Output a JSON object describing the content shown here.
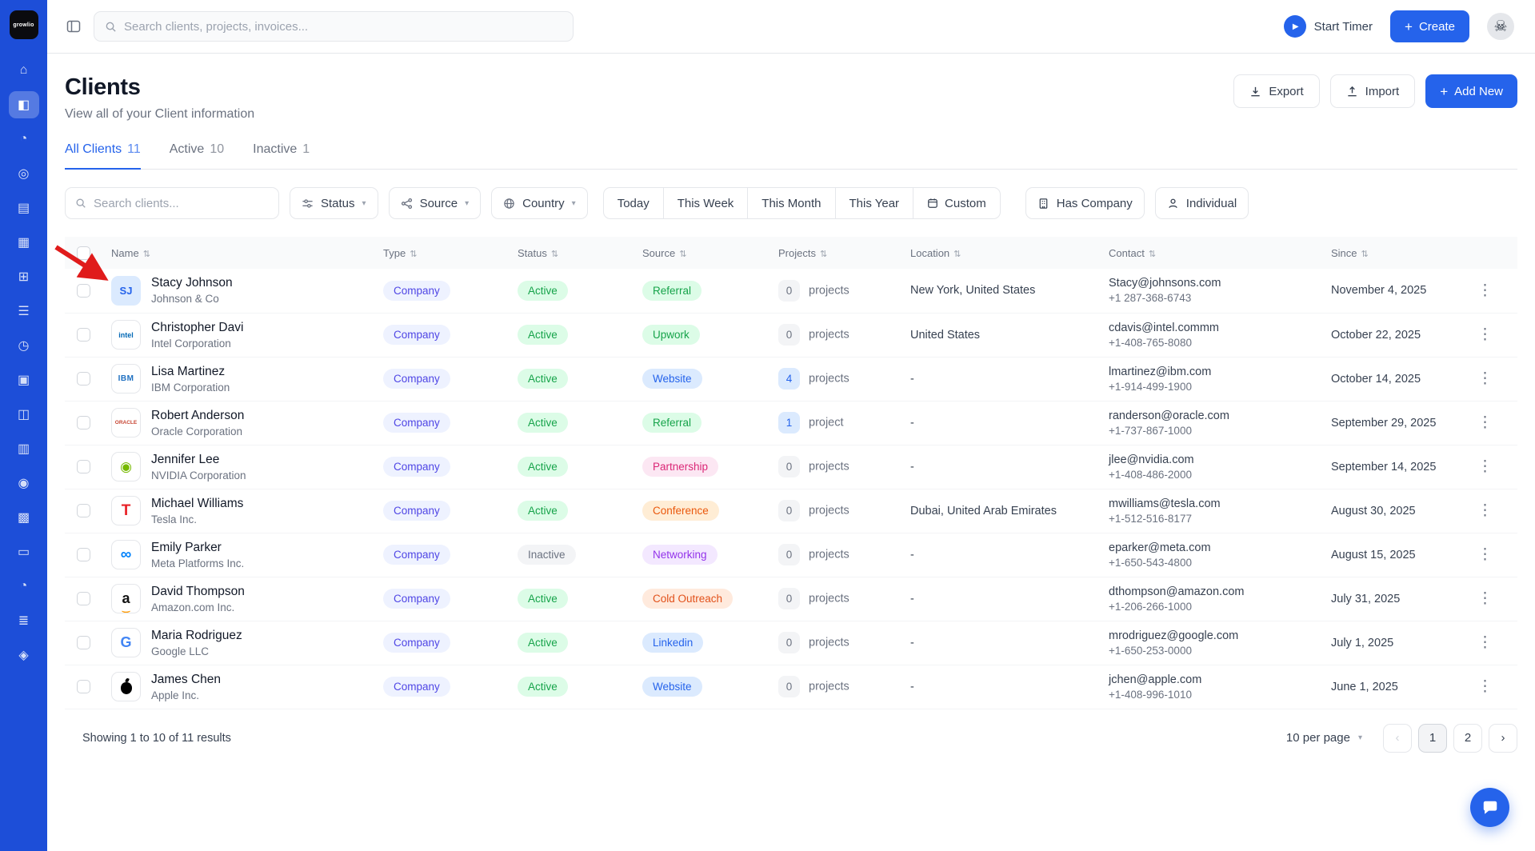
{
  "brand": "growlio",
  "colors": {
    "accent": "#2563eb",
    "sidebar": "#1d4ed8"
  },
  "sidebar": {
    "active": "clients",
    "icons": [
      "home",
      "clients",
      "contacts",
      "payments",
      "projects",
      "layers",
      "products",
      "tasks",
      "time",
      "inventory",
      "store",
      "billing",
      "finance",
      "modules",
      "cards",
      "history",
      "reports",
      "team"
    ]
  },
  "topbar": {
    "search_placeholder": "Search clients, projects, invoices...",
    "start_timer_label": "Start Timer",
    "create_label": "Create"
  },
  "page": {
    "title": "Clients",
    "subtitle": "View all of your Client information",
    "export_label": "Export",
    "import_label": "Import",
    "add_new_label": "Add New"
  },
  "tabs": [
    {
      "label": "All Clients",
      "count": "11"
    },
    {
      "label": "Active",
      "count": "10"
    },
    {
      "label": "Inactive",
      "count": "1"
    }
  ],
  "filters": {
    "search_placeholder": "Search clients...",
    "status_label": "Status",
    "source_label": "Source",
    "country_label": "Country",
    "date_ranges": [
      "Today",
      "This Week",
      "This Month",
      "This Year",
      "Custom"
    ],
    "has_company_label": "Has Company",
    "individual_label": "Individual"
  },
  "table": {
    "columns": [
      "Name",
      "Type",
      "Status",
      "Source",
      "Projects",
      "Location",
      "Contact",
      "Since"
    ],
    "rows": [
      {
        "name": "Stacy Johnson",
        "company": "Johnson & Co",
        "avatar": {
          "text": "SJ",
          "style": "sj"
        },
        "type": "Company",
        "status": "Active",
        "source": {
          "label": "Referral",
          "color": "green"
        },
        "projects": {
          "count": "0",
          "label": "projects"
        },
        "location": "New York, United States",
        "email": "Stacy@johnsons.com",
        "phone": "+1 287-368-6743",
        "since": "November 4, 2025"
      },
      {
        "name": "Christopher Davi",
        "company": "Intel Corporation",
        "avatar": {
          "text": "intel",
          "style": "intel"
        },
        "type": "Company",
        "status": "Active",
        "source": {
          "label": "Upwork",
          "color": "green"
        },
        "projects": {
          "count": "0",
          "label": "projects"
        },
        "location": "United States",
        "email": "cdavis@intel.commm",
        "phone": "+1-408-765-8080",
        "since": "October 22, 2025"
      },
      {
        "name": "Lisa Martinez",
        "company": "IBM Corporation",
        "avatar": {
          "text": "IBM",
          "style": "ibm"
        },
        "type": "Company",
        "status": "Active",
        "source": {
          "label": "Website",
          "color": "blue"
        },
        "projects": {
          "count": "4",
          "label": "projects"
        },
        "location": "-",
        "email": "lmartinez@ibm.com",
        "phone": "+1-914-499-1900",
        "since": "October 14, 2025"
      },
      {
        "name": "Robert Anderson",
        "company": "Oracle Corporation",
        "avatar": {
          "text": "ORACLE",
          "style": "oracle"
        },
        "type": "Company",
        "status": "Active",
        "source": {
          "label": "Referral",
          "color": "green"
        },
        "projects": {
          "count": "1",
          "label": "project"
        },
        "location": "-",
        "email": "randerson@oracle.com",
        "phone": "+1-737-867-1000",
        "since": "September 29, 2025"
      },
      {
        "name": "Jennifer Lee",
        "company": "NVIDIA Corporation",
        "avatar": {
          "text": "◉",
          "style": "nvidia"
        },
        "type": "Company",
        "status": "Active",
        "source": {
          "label": "Partnership",
          "color": "pink"
        },
        "projects": {
          "count": "0",
          "label": "projects"
        },
        "location": "-",
        "email": "jlee@nvidia.com",
        "phone": "+1-408-486-2000",
        "since": "September 14, 2025"
      },
      {
        "name": "Michael Williams",
        "company": "Tesla Inc.",
        "avatar": {
          "text": "T",
          "style": "tesla"
        },
        "type": "Company",
        "status": "Active",
        "source": {
          "label": "Conference",
          "color": "orange"
        },
        "projects": {
          "count": "0",
          "label": "projects"
        },
        "location": "Dubai, United Arab Emirates",
        "email": "mwilliams@tesla.com",
        "phone": "+1-512-516-8177",
        "since": "August 30, 2025"
      },
      {
        "name": "Emily Parker",
        "company": "Meta Platforms Inc.",
        "avatar": {
          "text": "∞",
          "style": "meta"
        },
        "type": "Company",
        "status": "Inactive",
        "source": {
          "label": "Networking",
          "color": "purple"
        },
        "projects": {
          "count": "0",
          "label": "projects"
        },
        "location": "-",
        "email": "eparker@meta.com",
        "phone": "+1-650-543-4800",
        "since": "August 15, 2025"
      },
      {
        "name": "David Thompson",
        "company": "Amazon.com Inc.",
        "avatar": {
          "text": "a",
          "style": "amazon"
        },
        "type": "Company",
        "status": "Active",
        "source": {
          "label": "Cold Outreach",
          "color": "coral"
        },
        "projects": {
          "count": "0",
          "label": "projects"
        },
        "location": "-",
        "email": "dthompson@amazon.com",
        "phone": "+1-206-266-1000",
        "since": "July 31, 2025"
      },
      {
        "name": "Maria Rodriguez",
        "company": "Google LLC",
        "avatar": {
          "text": "G",
          "style": "google"
        },
        "type": "Company",
        "status": "Active",
        "source": {
          "label": "Linkedin",
          "color": "blue"
        },
        "projects": {
          "count": "0",
          "label": "projects"
        },
        "location": "-",
        "email": "mrodriguez@google.com",
        "phone": "+1-650-253-0000",
        "since": "July 1, 2025"
      },
      {
        "name": "James Chen",
        "company": "Apple Inc.",
        "avatar": {
          "text": "",
          "style": "apple"
        },
        "type": "Company",
        "status": "Active",
        "source": {
          "label": "Website",
          "color": "blue"
        },
        "projects": {
          "count": "0",
          "label": "projects"
        },
        "location": "-",
        "email": "jchen@apple.com",
        "phone": "+1-408-996-1010",
        "since": "June 1, 2025"
      }
    ]
  },
  "footer": {
    "showing": "Showing 1 to 10 of 11 results",
    "per_page": "10 per page",
    "pages": [
      "1",
      "2"
    ]
  },
  "annotation": {
    "type": "arrow",
    "color": "#e01b1b",
    "points_at": "first-row-avatar"
  }
}
